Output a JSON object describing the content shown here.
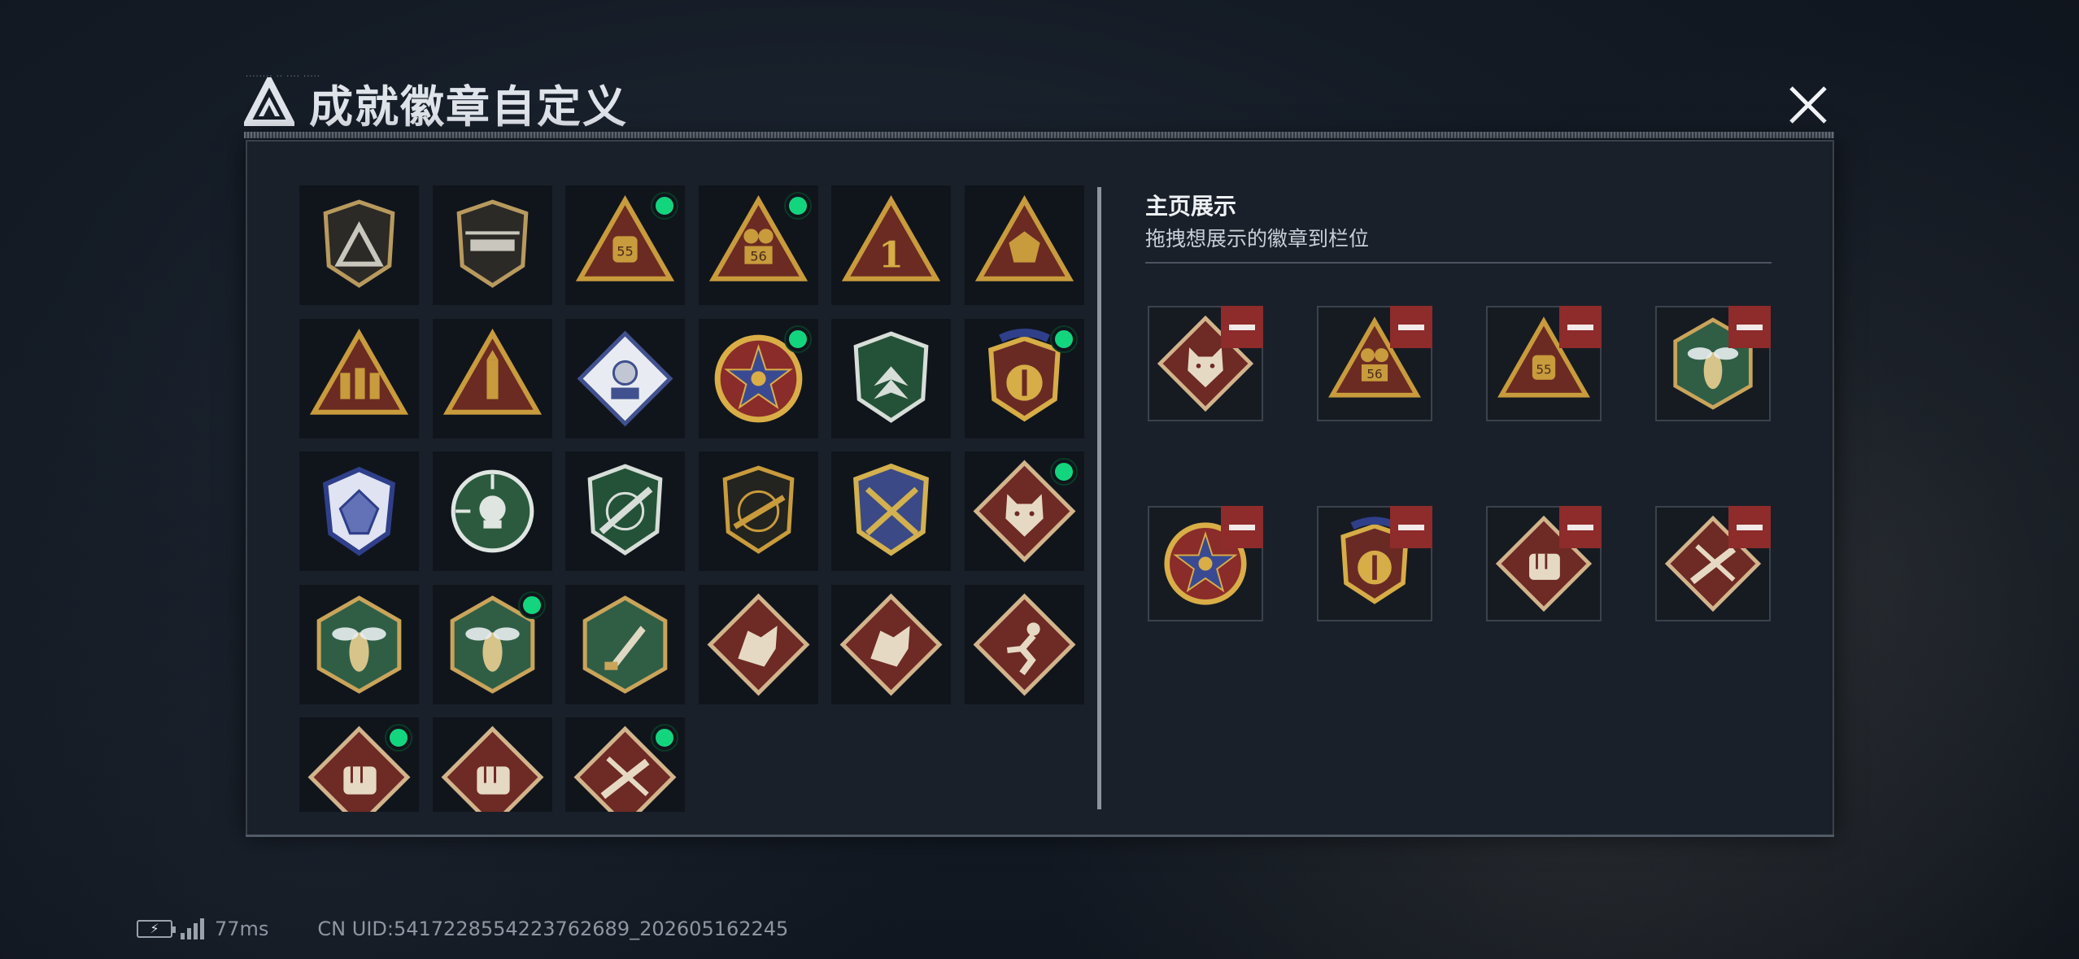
{
  "window": {
    "title": "成就徽章自定义",
    "tiny_caption": "........ .. .... .....",
    "close_icon": "close-x-icon"
  },
  "colors": {
    "panel_bg": "#1a2029",
    "tile_bg": "#10151c",
    "new_dot": "#13d57e",
    "remove_button": "#8e2b2b",
    "gold": "#c89b3c",
    "maroon": "#6e2a24",
    "green": "#2f5e45"
  },
  "badges": [
    {
      "name": "triangle-logo-shield-badge",
      "new": false
    },
    {
      "name": "helicopter-shield-badge",
      "new": false
    },
    {
      "name": "55-medal-badge",
      "new": true
    },
    {
      "name": "56-medal-badge",
      "new": true
    },
    {
      "name": "number-1-badge",
      "new": false
    },
    {
      "name": "d20-dice-badge",
      "new": false
    },
    {
      "name": "soldiers-badge",
      "new": false
    },
    {
      "name": "rocket-badge",
      "new": false
    },
    {
      "name": "silver-gear-badge",
      "new": false
    },
    {
      "name": "star-compass-badge",
      "new": true
    },
    {
      "name": "green-chevron-badge",
      "new": false
    },
    {
      "name": "blue-ribbon-gold-badge",
      "new": true
    },
    {
      "name": "blue-crystal-badge",
      "new": false
    },
    {
      "name": "skull-crosshair-badge",
      "new": false
    },
    {
      "name": "rifle-crosshair-badge",
      "new": false
    },
    {
      "name": "sniper-rifle-badge",
      "new": false
    },
    {
      "name": "crossed-rifles-badge",
      "new": false
    },
    {
      "name": "wolf-head-badge",
      "new": true
    },
    {
      "name": "hornet-badge",
      "new": false
    },
    {
      "name": "hornet-badge-2",
      "new": true
    },
    {
      "name": "knife-badge",
      "new": false
    },
    {
      "name": "dragon-badge",
      "new": false
    },
    {
      "name": "dragon-badge-2",
      "new": false
    },
    {
      "name": "runner-badge",
      "new": false
    },
    {
      "name": "fist-badge",
      "new": true
    },
    {
      "name": "fist-badge-2",
      "new": false
    },
    {
      "name": "crossed-knives-badge",
      "new": true
    }
  ],
  "display": {
    "title": "主页展示",
    "subtitle": "拖拽想展示的徽章到栏位",
    "slots": [
      {
        "badge": "wolf-head-badge"
      },
      {
        "badge": "56-medal-badge"
      },
      {
        "badge": "55-medal-badge"
      },
      {
        "badge": "hornet-badge"
      },
      {
        "badge": "star-compass-badge"
      },
      {
        "badge": "blue-ribbon-gold-badge"
      },
      {
        "badge": "fist-badge"
      },
      {
        "badge": "crossed-knives-badge"
      }
    ]
  },
  "status_bar": {
    "battery_icon": "battery-charging-icon",
    "signal_icon": "signal-bars-icon",
    "ping": "77ms",
    "uid": "CN UID:5417228554223762689_202605162245"
  }
}
